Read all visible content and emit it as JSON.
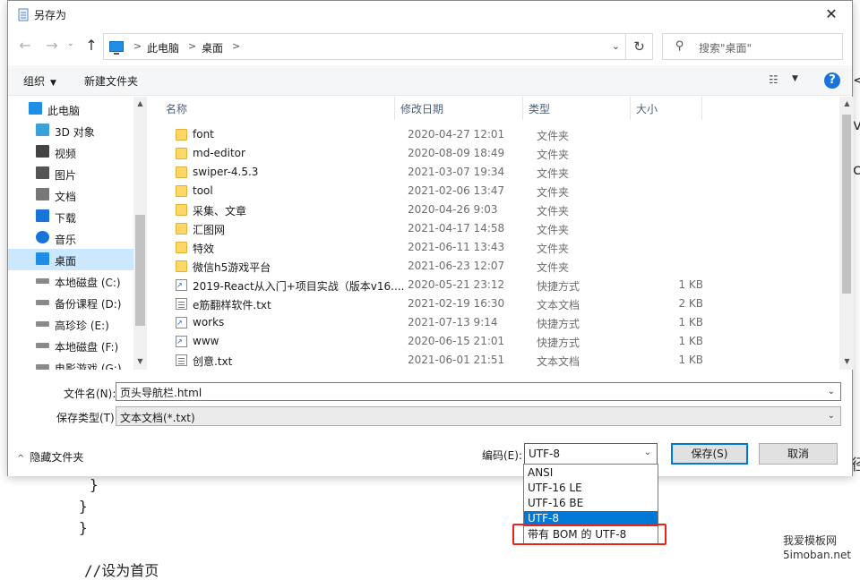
{
  "background": {
    "code_lines": [
      "}",
      "}",
      "}",
      "//设为首页"
    ],
    "right_edge": [
      "<",
      "v",
      "c",
      "径"
    ],
    "watermark": [
      "我爱模板网",
      "5imoban.net"
    ]
  },
  "dialog": {
    "title": "另存为",
    "close_glyph": "✕",
    "nav": {
      "back": "←",
      "forward": "→",
      "dropdown": "⌄",
      "up": "↑"
    },
    "breadcrumb": [
      "此电脑",
      "桌面"
    ],
    "crumb_sep": ">",
    "refresh": "↻",
    "search_placeholder": "搜索\"桌面\"",
    "toolbar": {
      "organize": "组织",
      "new_folder": "新建文件夹",
      "help": "?"
    },
    "sidebar": {
      "items": [
        {
          "label": "此电脑",
          "icon": "computer-icon",
          "color": "#1e8ee6"
        },
        {
          "label": "3D 对象",
          "icon": "cube-icon",
          "color": "#3aa0d8"
        },
        {
          "label": "视频",
          "icon": "video-icon",
          "color": "#444444"
        },
        {
          "label": "图片",
          "icon": "picture-icon",
          "color": "#555555"
        },
        {
          "label": "文档",
          "icon": "document-icon",
          "color": "#777777"
        },
        {
          "label": "下载",
          "icon": "download-icon",
          "color": "#1a73d9"
        },
        {
          "label": "音乐",
          "icon": "music-icon",
          "color": "#1a73d9"
        },
        {
          "label": "桌面",
          "icon": "desktop-icon",
          "color": "#1e8ee6"
        },
        {
          "label": "本地磁盘 (C:)",
          "icon": "drive-icon",
          "color": "#777777"
        },
        {
          "label": "备份课程 (D:)",
          "icon": "drive-icon",
          "color": "#777777"
        },
        {
          "label": "高珍珍 (E:)",
          "icon": "drive-icon",
          "color": "#777777"
        },
        {
          "label": "本地磁盘 (F:)",
          "icon": "drive-icon",
          "color": "#777777"
        },
        {
          "label": "电影游戏 (G:)",
          "icon": "drive-icon",
          "color": "#777777"
        }
      ]
    },
    "columns": {
      "name": "名称",
      "date": "修改日期",
      "type": "类型",
      "size": "大小"
    },
    "files": [
      {
        "name": "font",
        "date": "2020-04-27 12:01",
        "type": "文件夹",
        "size": "",
        "kind": "folder"
      },
      {
        "name": "md-editor",
        "date": "2020-08-09 18:49",
        "type": "文件夹",
        "size": "",
        "kind": "folder"
      },
      {
        "name": "swiper-4.5.3",
        "date": "2021-03-07 19:34",
        "type": "文件夹",
        "size": "",
        "kind": "folder"
      },
      {
        "name": "tool",
        "date": "2021-02-06 13:47",
        "type": "文件夹",
        "size": "",
        "kind": "folder"
      },
      {
        "name": "采集、文章",
        "date": "2020-04-26 9:03",
        "type": "文件夹",
        "size": "",
        "kind": "folder"
      },
      {
        "name": "汇图网",
        "date": "2021-04-17 14:58",
        "type": "文件夹",
        "size": "",
        "kind": "folder"
      },
      {
        "name": "特效",
        "date": "2021-06-11 13:43",
        "type": "文件夹",
        "size": "",
        "kind": "folder"
      },
      {
        "name": "微信h5游戏平台",
        "date": "2021-06-23 12:07",
        "type": "文件夹",
        "size": "",
        "kind": "folder"
      },
      {
        "name": "2019-React从入门+项目实战（版本v16....",
        "date": "2020-05-21 23:12",
        "type": "快捷方式",
        "size": "1 KB",
        "kind": "shortcut"
      },
      {
        "name": "e筋翻样软件.txt",
        "date": "2021-02-19 16:30",
        "type": "文本文档",
        "size": "2 KB",
        "kind": "txt"
      },
      {
        "name": "works",
        "date": "2021-07-13 9:14",
        "type": "快捷方式",
        "size": "1 KB",
        "kind": "shortcut"
      },
      {
        "name": "www",
        "date": "2020-06-15 21:01",
        "type": "快捷方式",
        "size": "1 KB",
        "kind": "shortcut"
      },
      {
        "name": "创意.txt",
        "date": "2021-06-01 21:51",
        "type": "文本文档",
        "size": "1 KB",
        "kind": "txt"
      }
    ],
    "filename_label": "文件名(N):",
    "filename_value": "页头导航栏.html",
    "filetype_label": "保存类型(T):",
    "filetype_value": "文本文档(*.txt)",
    "hide_folders": "隐藏文件夹",
    "encoding_label": "编码(E):",
    "encoding_value": "UTF-8",
    "save": "保存(S)",
    "cancel": "取消",
    "encoding_options": [
      "ANSI",
      "UTF-16 LE",
      "UTF-16 BE",
      "UTF-8",
      "带有 BOM 的 UTF-8"
    ],
    "encoding_selected_index": 3,
    "accent_color": "#0078d7",
    "highlight_color": "#e8241c"
  }
}
